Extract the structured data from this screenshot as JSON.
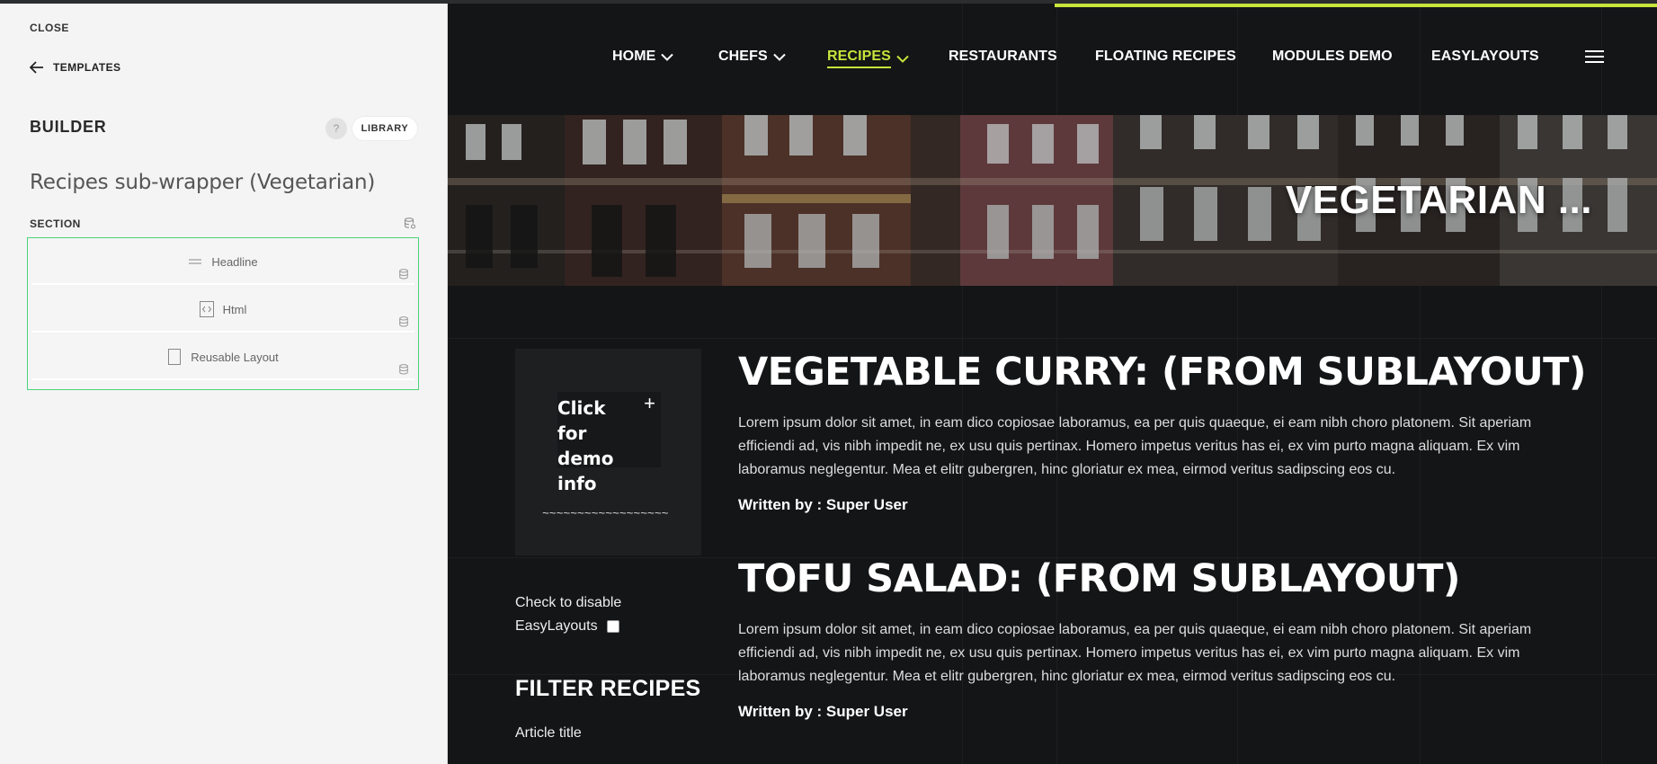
{
  "panel": {
    "close_label": "CLOSE",
    "templates_label": "TEMPLATES",
    "builder_title": "BUILDER",
    "help_label": "?",
    "library_label": "LIBRARY",
    "wrapper_title": "Recipes sub-wrapper (Vegetarian)",
    "section_label": "SECTION",
    "blocks": [
      {
        "label": "Headline",
        "icon": "headline-icon"
      },
      {
        "label": "Html",
        "icon": "html-code-icon"
      },
      {
        "label": "Reusable Layout",
        "icon": "reusable-layout-icon"
      }
    ],
    "accent_color": "#4cd37a"
  },
  "site": {
    "accent_color": "#c6e43a",
    "nav": [
      {
        "label": "HOME",
        "dropdown": true,
        "active": false
      },
      {
        "label": "CHEFS",
        "dropdown": true,
        "active": false
      },
      {
        "label": "RECIPES",
        "dropdown": true,
        "active": true
      },
      {
        "label": "RESTAURANTS",
        "dropdown": false,
        "active": false
      },
      {
        "label": "FLOATING RECIPES",
        "dropdown": false,
        "active": false
      },
      {
        "label": "MODULES DEMO",
        "dropdown": false,
        "active": false
      },
      {
        "label": "EASYLAYOUTS",
        "dropdown": false,
        "active": false
      }
    ],
    "hero_title": "VEGETARIAN ...",
    "demo": {
      "text": "Click for demo info",
      "plus": "+",
      "tilde": "~~~~~~~~~~~~~~~~~~"
    },
    "disable_line1": "Check to disable",
    "disable_line2": "EasyLayouts",
    "filter_title": "FILTER RECIPES",
    "article_title_label": "Article title",
    "articles": [
      {
        "title": "VEGETABLE CURRY: (FROM SUBLAYOUT)",
        "body": "Lorem ipsum dolor sit amet, in eam dico copiosae laboramus, ea per quis quaeque, ei eam nibh choro platonem. Sit aperiam efficiendi ad, vis nibh impedit ne, ex usu quis pertinax. Homero impetus veritus has ei, ex vim purto magna aliquam. Ex vim laboramus neglegentur. Mea et elitr gubergren, hinc gloriatur ex mea, eirmod veritus sadipscing eos cu.",
        "author": "Written by : Super User"
      },
      {
        "title": "TOFU SALAD: (FROM SUBLAYOUT)",
        "body": "Lorem ipsum dolor sit amet, in eam dico copiosae laboramus, ea per quis quaeque, ei eam nibh choro platonem. Sit aperiam efficiendi ad, vis nibh impedit ne, ex usu quis pertinax. Homero impetus veritus has ei, ex vim purto magna aliquam. Ex vim laboramus neglegentur. Mea et elitr gubergren, hinc gloriatur ex mea, eirmod veritus sadipscing eos cu.",
        "author": "Written by : Super User"
      }
    ]
  }
}
